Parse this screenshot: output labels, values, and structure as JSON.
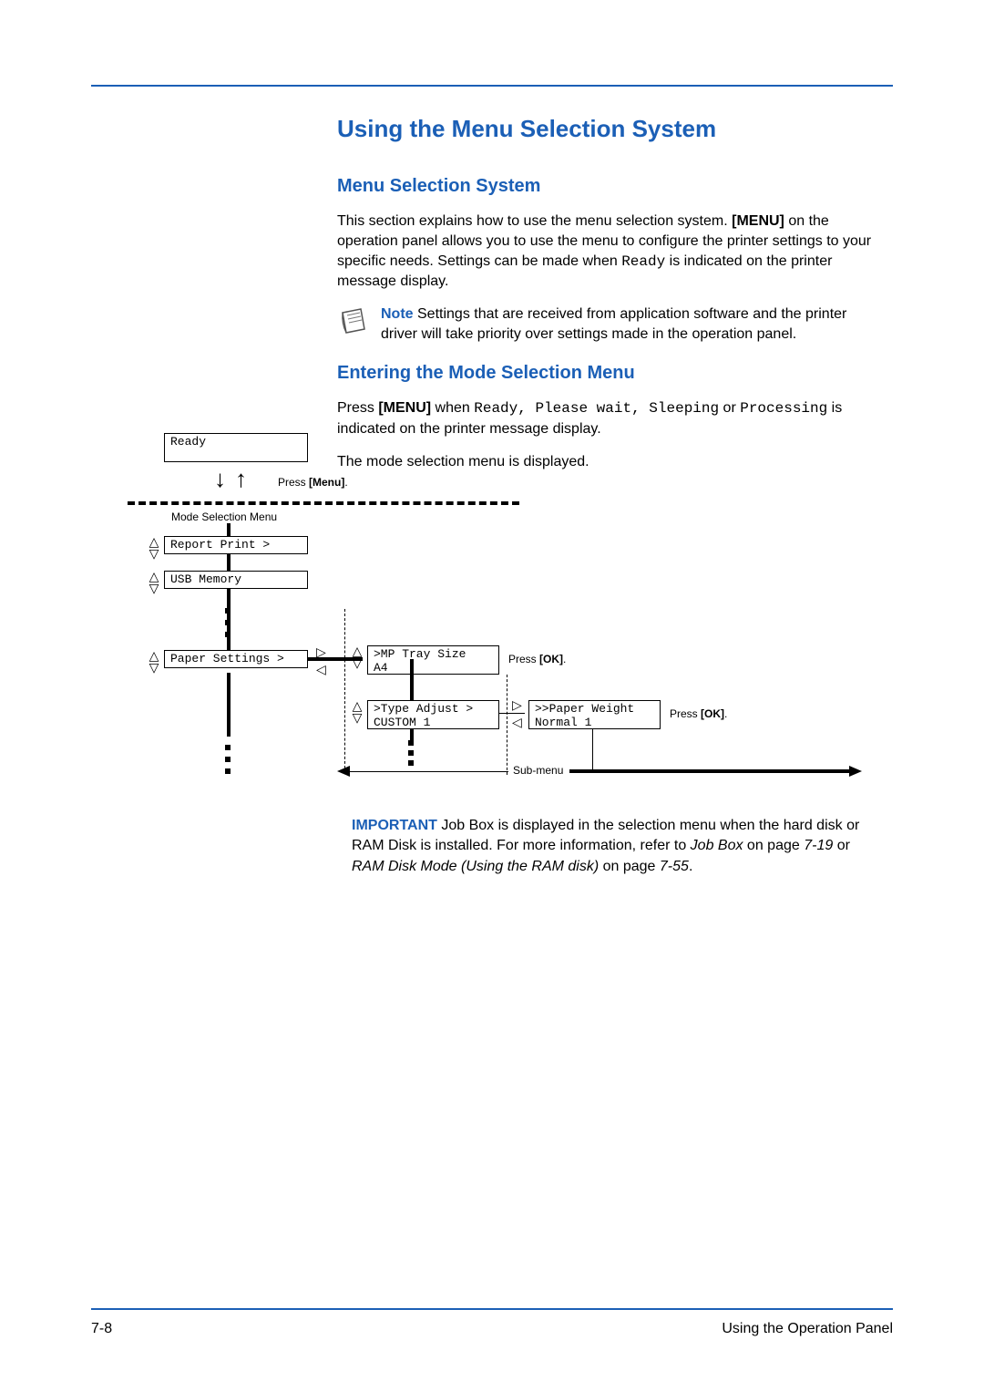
{
  "heading_main": "Using the Menu Selection System",
  "heading_sub1": "Menu Selection System",
  "para1_a": "This section explains how to use the menu selection system. ",
  "para1_menu": "[MENU]",
  "para1_b": " on the operation panel allows you to use the menu to configure the printer settings to your specific needs. Settings can be made when ",
  "para1_ready": "Ready",
  "para1_c": " is indicated on the printer message display.",
  "note_label": "Note",
  "note_text": "  Settings that are received from application software and the printer driver will take priority over settings made in the operation panel.",
  "heading_sub2": "Entering the Mode Selection Menu",
  "para2_a": "Press ",
  "para2_menu": "[MENU]",
  "para2_b": " when ",
  "para2_states": "Ready, Please wait, Sleeping",
  "para2_or": " or ",
  "para2_proc": "Processing",
  "para2_c": " is indicated on the printer message display.",
  "para3": "The mode selection menu is displayed.",
  "diagram": {
    "ready": "Ready",
    "press_menu": "Press [Menu].",
    "mode_sel": "Mode Selection Menu",
    "report_print": "Report Print    >",
    "usb_memory": "USB Memory",
    "paper_settings": "Paper Settings  >",
    "mp_tray_l1": ">MP Tray Size",
    "mp_tray_l2": "  A4",
    "type_adj_l1": ">Type Adjust    >",
    "type_adj_l2": "  CUSTOM 1",
    "paper_wt_l1": ">>Paper Weight",
    "paper_wt_l2": "  Normal 1",
    "press_ok": "Press [OK].",
    "sub_menu": "Sub-menu"
  },
  "important_label": "IMPORTANT",
  "important_a": "  Job Box is displayed in the selection menu when the hard disk or RAM Disk is installed. For more information, refer to ",
  "important_i1": "Job Box",
  "important_b": " on page ",
  "important_p1": "7-19",
  "important_c": " or  ",
  "important_i2": "RAM Disk Mode (Using the RAM disk)",
  "important_d": " on page ",
  "important_p2": "7-55",
  "important_e": ".",
  "footer_left": "7-8",
  "footer_right": "Using the Operation Panel"
}
